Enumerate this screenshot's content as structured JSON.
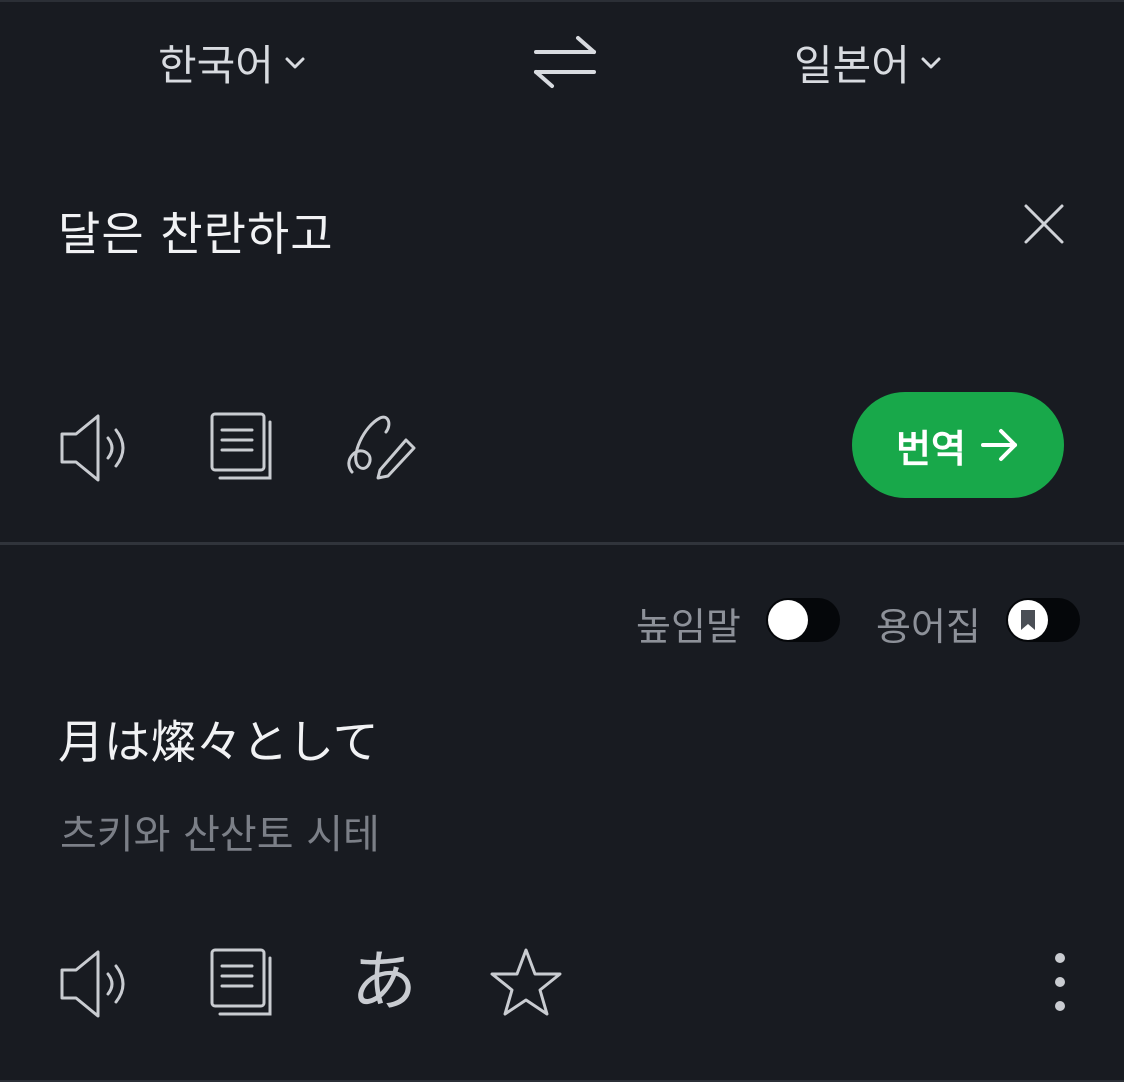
{
  "header": {
    "source_language": "한국어",
    "target_language": "일본어"
  },
  "input": {
    "text": "달은 찬란하고"
  },
  "actions": {
    "translate_label": "번역"
  },
  "options": {
    "honorific_label": "높임말",
    "honorific_on": false,
    "glossary_label": "용어집",
    "glossary_on": false
  },
  "result": {
    "text": "月は燦々として",
    "pronunciation": "츠키와 산산토 시테",
    "kana_glyph": "あ"
  },
  "icons": [
    "chevron-down-icon",
    "swap-icon",
    "close-icon",
    "speaker-icon",
    "copy-icon",
    "handwriting-icon",
    "arrow-right-icon",
    "bookmark-icon",
    "kana-icon",
    "star-icon",
    "more-vertical-icon"
  ],
  "colors": {
    "background": "#181b21",
    "accent": "#18a84a",
    "text_primary": "#f1f2f4",
    "text_secondary": "#7b7f87"
  }
}
